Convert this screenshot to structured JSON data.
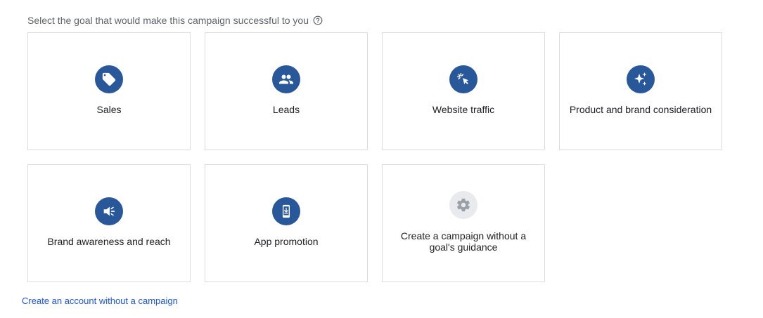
{
  "heading": "Select the goal that would make this campaign successful to you",
  "goals": [
    {
      "label": "Sales",
      "icon": "tag-icon"
    },
    {
      "label": "Leads",
      "icon": "people-icon"
    },
    {
      "label": "Website traffic",
      "icon": "cursor-click-icon"
    },
    {
      "label": "Product and brand consideration",
      "icon": "sparkle-icon"
    },
    {
      "label": "Brand awareness and reach",
      "icon": "megaphone-icon"
    },
    {
      "label": "App promotion",
      "icon": "phone-download-icon"
    },
    {
      "label": "Create a campaign without a goal's guidance",
      "icon": "gear-icon"
    }
  ],
  "footer_link": "Create an account without a campaign",
  "colors": {
    "accent": "#28579a",
    "link": "#1a55d6",
    "border": "#dadce0"
  }
}
